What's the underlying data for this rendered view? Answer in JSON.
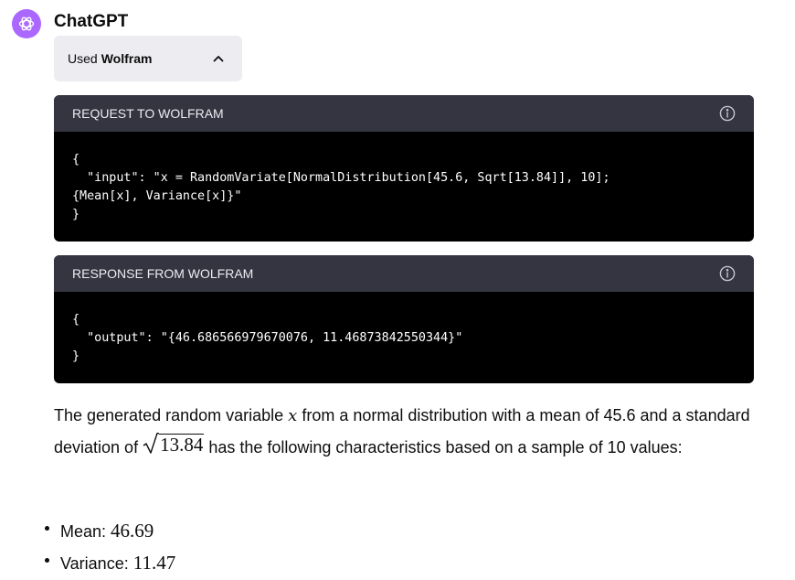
{
  "message": {
    "author": "ChatGPT",
    "brand_color": "#ab68ff"
  },
  "tool_usage": {
    "prefix": "Used",
    "tool": "Wolfram",
    "expanded": true,
    "toggle_icon": "chevron-up-icon"
  },
  "request": {
    "header": "REQUEST TO WOLFRAM",
    "info_icon": "info-icon",
    "code": "{\n  \"input\": \"x = RandomVariate[NormalDistribution[45.6, Sqrt[13.84]], 10];\n{Mean[x], Variance[x]}\"\n}"
  },
  "response": {
    "header": "RESPONSE FROM WOLFRAM",
    "info_icon": "info-icon",
    "code": "{\n  \"output\": \"{46.686566979670076, 11.46873842550344}\"\n}"
  },
  "answer": {
    "part1": "The generated random variable ",
    "var": "x",
    "part2": " from a normal distribution with a mean of 45.6 and a standard deviation of ",
    "sqrt_value": "13.84",
    "part3": " has the following characteristics based on a sample of 10 values:"
  },
  "stats": [
    {
      "label": "Mean: ",
      "value": "46.69"
    },
    {
      "label": "Variance: ",
      "value": "11.47"
    }
  ]
}
